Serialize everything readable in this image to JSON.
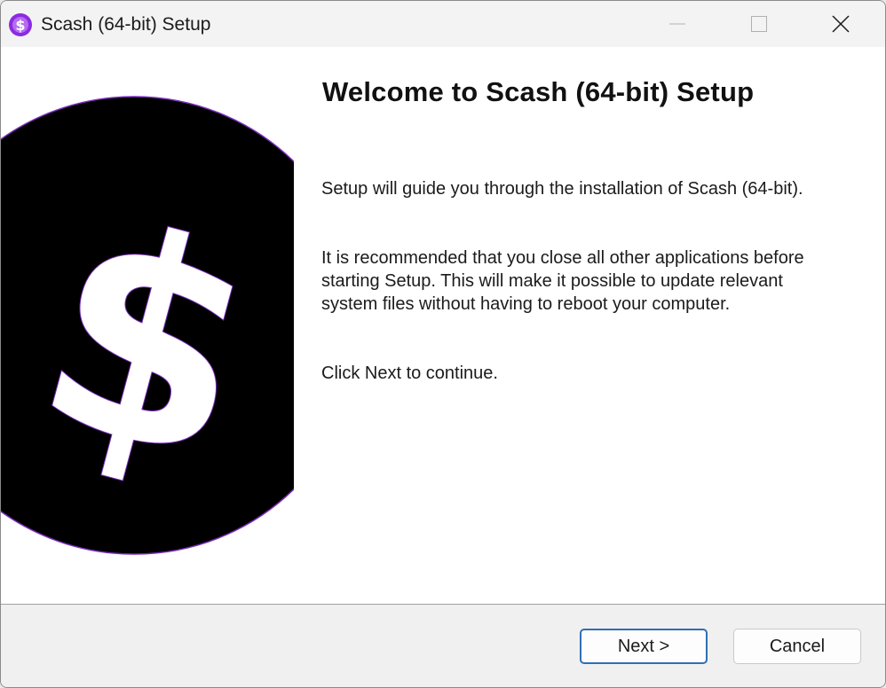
{
  "window": {
    "title": "Scash (64-bit) Setup",
    "icon": "scash-logo-icon",
    "controls": [
      "minimize-icon",
      "maximize-icon",
      "close-icon"
    ]
  },
  "banner": {
    "icon": "dollar-coin-icon",
    "colors": {
      "coin": "#000000",
      "symbol": "#ffffff",
      "accent": "#7b2fbe"
    }
  },
  "main": {
    "heading": "Welcome to Scash (64-bit) Setup",
    "paragraphs": [
      "Setup will guide you through the installation of Scash (64-bit).",
      "It is recommended that you close all other applications before starting Setup. This will make it possible to update relevant system files without having to reboot your computer.",
      "Click Next to continue."
    ]
  },
  "footer": {
    "next_label": "Next >",
    "cancel_label": "Cancel"
  }
}
